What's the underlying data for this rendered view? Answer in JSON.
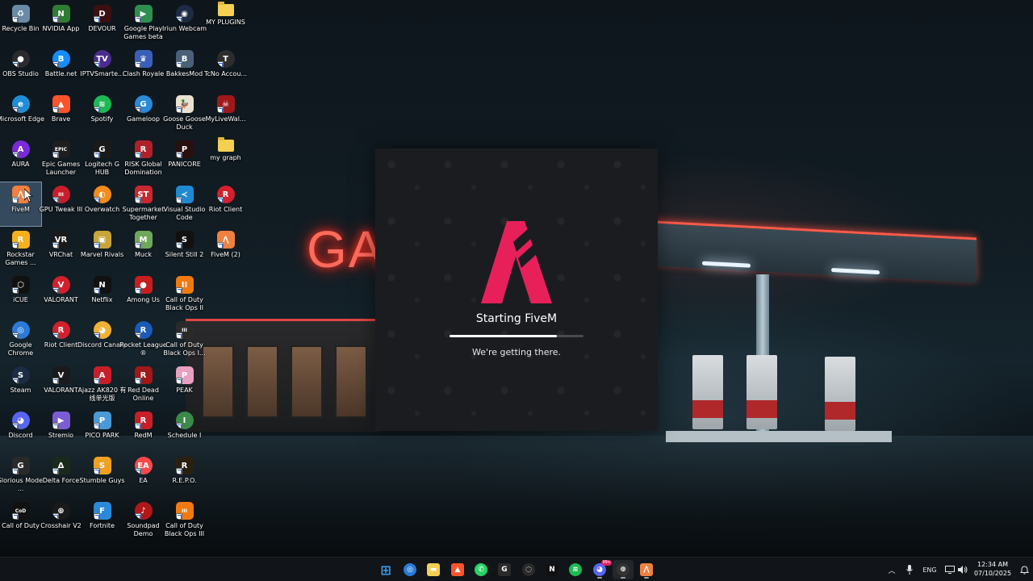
{
  "desktop": {
    "icons": [
      {
        "label": "Recycle Bin",
        "icon": "recycle-bin-icon",
        "color": "#6a8aa8",
        "glyph": "♻",
        "round": false
      },
      {
        "label": "NVIDIA App",
        "icon": "nvidia-icon",
        "color": "#2e7d32",
        "glyph": "N",
        "round": false
      },
      {
        "label": "DEVOUR",
        "icon": "devour-icon",
        "color": "#3a1010",
        "glyph": "D",
        "round": false
      },
      {
        "label": "Google Play Games beta",
        "icon": "google-play-games-icon",
        "color": "#2f8f4e",
        "glyph": "▶",
        "round": false
      },
      {
        "label": "Iriun Webcam",
        "icon": "iriun-webcam-icon",
        "color": "#1f2a44",
        "glyph": "◉",
        "round": true
      },
      {
        "label": "MY PLUGINS",
        "icon": "folder-icon",
        "color": "#f5cf52",
        "glyph": "",
        "round": false
      },
      {
        "label": "OBS Studio",
        "icon": "obs-studio-icon",
        "color": "#2b2b2f",
        "glyph": "●",
        "round": true
      },
      {
        "label": "Battle.net",
        "icon": "battlenet-icon",
        "color": "#148eff",
        "glyph": "B",
        "round": true
      },
      {
        "label": "IPTVSmarte...",
        "icon": "iptv-smarters-icon",
        "color": "#4b2c8c",
        "glyph": "TV",
        "round": true
      },
      {
        "label": "Clash Royale",
        "icon": "clash-royale-icon",
        "color": "#3a5fb8",
        "glyph": "♛",
        "round": false
      },
      {
        "label": "BakkesMod",
        "icon": "bakkesmod-icon",
        "color": "#4a6078",
        "glyph": "B",
        "round": false
      },
      {
        "label": "TcNo Accou...",
        "icon": "tcno-account-switcher-icon",
        "color": "#2d2d2d",
        "glyph": "T",
        "round": true
      },
      {
        "label": "Microsoft Edge",
        "icon": "edge-icon",
        "color": "#1f8ed6",
        "glyph": "e",
        "round": true
      },
      {
        "label": "Brave",
        "icon": "brave-icon",
        "color": "#fb542b",
        "glyph": "▲",
        "round": false
      },
      {
        "label": "Spotify",
        "icon": "spotify-icon",
        "color": "#1db954",
        "glyph": "≋",
        "round": true
      },
      {
        "label": "Gameloop",
        "icon": "gameloop-icon",
        "color": "#2a8ad8",
        "glyph": "G",
        "round": true
      },
      {
        "label": "Goose Goose Duck",
        "icon": "goose-goose-duck-icon",
        "color": "#e9e2d2",
        "glyph": "🦆",
        "round": false
      },
      {
        "label": "MyLiveWal...",
        "icon": "mylivewallpaper-icon",
        "color": "#a01818",
        "glyph": "☠",
        "round": false
      },
      {
        "label": "AURA",
        "icon": "aura-icon",
        "color": "#7a2ad8",
        "glyph": "A",
        "round": true
      },
      {
        "label": "Epic Games Launcher",
        "icon": "epic-games-icon",
        "color": "#1e1e1e",
        "glyph": "EPIC",
        "round": false
      },
      {
        "label": "Logitech G HUB",
        "icon": "logitech-g-hub-icon",
        "color": "#1a1a1a",
        "glyph": "G",
        "round": false
      },
      {
        "label": "RISK Global Domination",
        "icon": "risk-icon",
        "color": "#b0202a",
        "glyph": "R",
        "round": false
      },
      {
        "label": "PANICORE",
        "icon": "panicore-icon",
        "color": "#2a0f0f",
        "glyph": "P",
        "round": false
      },
      {
        "label": "my graph",
        "icon": "folder-icon",
        "color": "#f5cf52",
        "glyph": "",
        "round": false
      },
      {
        "label": "FiveM",
        "icon": "fivem-icon",
        "color": "#f08040",
        "glyph": "⋀",
        "round": false
      },
      {
        "label": "GPU Tweak III",
        "icon": "gpu-tweak-icon",
        "color": "#c81e2a",
        "glyph": "III",
        "round": true
      },
      {
        "label": "Overwatch",
        "icon": "overwatch-icon",
        "color": "#f28c1b",
        "glyph": "◐",
        "round": true
      },
      {
        "label": "Supermarket Together",
        "icon": "supermarket-together-icon",
        "color": "#c8282e",
        "glyph": "ST",
        "round": false
      },
      {
        "label": "Visual Studio Code",
        "icon": "vscode-icon",
        "color": "#1f8ad2",
        "glyph": "≺",
        "round": false
      },
      {
        "label": "Riot Client",
        "icon": "riot-client-icon",
        "color": "#d4202c",
        "glyph": "R",
        "round": true
      },
      {
        "label": "Rockstar Games ...",
        "icon": "rockstar-games-icon",
        "color": "#f6b01a",
        "glyph": "R",
        "round": false
      },
      {
        "label": "VRChat",
        "icon": "vrchat-icon",
        "color": "#1a1a1a",
        "glyph": "VR",
        "round": false
      },
      {
        "label": "Marvel Rivals",
        "icon": "marvel-rivals-icon",
        "color": "#c8a53a",
        "glyph": "▣",
        "round": false
      },
      {
        "label": "Muck",
        "icon": "muck-icon",
        "color": "#6fa85a",
        "glyph": "M",
        "round": false
      },
      {
        "label": "Silent Still 2",
        "icon": "silent-still-icon",
        "color": "#111111",
        "glyph": "S",
        "round": false
      },
      {
        "label": "FiveM (2)",
        "icon": "fivem-icon",
        "color": "#f08040",
        "glyph": "⋀",
        "round": false
      },
      {
        "label": "iCUE",
        "icon": "icue-icon",
        "color": "#111111",
        "glyph": "⬡",
        "round": false
      },
      {
        "label": "VALORANT",
        "icon": "valorant-icon",
        "color": "#d4202c",
        "glyph": "V",
        "round": true
      },
      {
        "label": "Netflix",
        "icon": "netflix-icon",
        "color": "#111111",
        "glyph": "N",
        "round": false
      },
      {
        "label": "Among Us",
        "icon": "among-us-icon",
        "color": "#c81e1e",
        "glyph": "●",
        "round": false
      },
      {
        "label": "Call of Duty Black Ops II",
        "icon": "black-ops-icon",
        "color": "#f07a12",
        "glyph": "II",
        "round": false
      },
      {
        "label": "Google Chrome",
        "icon": "chrome-icon",
        "color": "#2a7ad8",
        "glyph": "◎",
        "round": true
      },
      {
        "label": "Riot Client",
        "icon": "riot-client-icon",
        "color": "#d4202c",
        "glyph": "R",
        "round": true
      },
      {
        "label": "Discord Canary",
        "icon": "discord-canary-icon",
        "color": "#f0b232",
        "glyph": "◕",
        "round": true
      },
      {
        "label": "Rocket League ®",
        "icon": "rocket-league-icon",
        "color": "#1a5ab8",
        "glyph": "R",
        "round": true
      },
      {
        "label": "Call of Duty Black Ops I...",
        "icon": "black-ops-icon",
        "color": "#2a2a2a",
        "glyph": "III",
        "round": false
      },
      {
        "label": "Steam",
        "icon": "steam-icon",
        "color": "#1b2c44",
        "glyph": "S",
        "round": true
      },
      {
        "label": "VALORANT",
        "icon": "valorant-icon",
        "color": "#1a1a1e",
        "glyph": "V",
        "round": false
      },
      {
        "label": "Ajazz AK820 有线单光版",
        "icon": "ajazz-keyboard-icon",
        "color": "#c81e2a",
        "glyph": "A",
        "round": false
      },
      {
        "label": "Red Dead Online",
        "icon": "red-dead-online-icon",
        "color": "#a01818",
        "glyph": "R",
        "round": false
      },
      {
        "label": "PEAK",
        "icon": "peak-icon",
        "color": "#e8a0c0",
        "glyph": "P",
        "round": false
      },
      {
        "label": "Discord",
        "icon": "discord-icon",
        "color": "#5865f2",
        "glyph": "◕",
        "round": true
      },
      {
        "label": "Stremio",
        "icon": "stremio-icon",
        "color": "#7b5bd6",
        "glyph": "▶",
        "round": false
      },
      {
        "label": "PICO PARK",
        "icon": "pico-park-icon",
        "color": "#4a9ad8",
        "glyph": "P",
        "round": false
      },
      {
        "label": "RedM",
        "icon": "redm-icon",
        "color": "#c81e2a",
        "glyph": "R",
        "round": false
      },
      {
        "label": "Schedule I",
        "icon": "schedule-one-icon",
        "color": "#3a8a4a",
        "glyph": "I",
        "round": true
      },
      {
        "label": "Glorious Model ...",
        "icon": "glorious-model-icon",
        "color": "#2a2a2a",
        "glyph": "G",
        "round": false
      },
      {
        "label": "Delta Force",
        "icon": "delta-force-icon",
        "color": "#1a2a1a",
        "glyph": "Δ",
        "round": false
      },
      {
        "label": "Stumble Guys",
        "icon": "stumble-guys-icon",
        "color": "#f0a020",
        "glyph": "S",
        "round": false
      },
      {
        "label": "EA",
        "icon": "ea-icon",
        "color": "#ff4747",
        "glyph": "EA",
        "round": true
      },
      {
        "label": "R.E.P.O.",
        "icon": "repo-icon",
        "color": "#2a2010",
        "glyph": "R",
        "round": false
      },
      {
        "label": "Call of Duty",
        "icon": "call-of-duty-icon",
        "color": "#111111",
        "glyph": "CoD",
        "round": false
      },
      {
        "label": "Crosshair V2",
        "icon": "crosshair-icon",
        "color": "#1a1a1a",
        "glyph": "⊕",
        "round": true
      },
      {
        "label": "Fortnite",
        "icon": "fortnite-icon",
        "color": "#2a8ad8",
        "glyph": "F",
        "round": false
      },
      {
        "label": "Soundpad Demo",
        "icon": "soundpad-icon",
        "color": "#b01818",
        "glyph": "♪",
        "round": true
      },
      {
        "label": "Call of Duty Black Ops III",
        "icon": "black-ops-icon",
        "color": "#f07a12",
        "glyph": "III",
        "round": false
      }
    ]
  },
  "splash": {
    "title": "Starting FiveM",
    "subtitle": "We're getting there.",
    "progress": 0.8,
    "accent": "#e8205a",
    "background": "#1b1c20"
  },
  "taskbar": {
    "apps": [
      {
        "name": "start-button",
        "icon": "windows-icon",
        "color": "#3aa0f0",
        "glyph": "⊞",
        "running": false,
        "active": false
      },
      {
        "name": "chrome-taskbar-button",
        "icon": "chrome-icon",
        "color": "#2a7ad8",
        "glyph": "◎",
        "running": false,
        "active": false
      },
      {
        "name": "file-explorer-taskbar-button",
        "icon": "folder-icon",
        "color": "#f5cf52",
        "glyph": "▬",
        "running": false,
        "active": false
      },
      {
        "name": "brave-taskbar-button",
        "icon": "brave-icon",
        "color": "#fb542b",
        "glyph": "▲",
        "running": false,
        "active": false
      },
      {
        "name": "whatsapp-taskbar-button",
        "icon": "whatsapp-icon",
        "color": "#25d366",
        "glyph": "✆",
        "running": false,
        "active": false
      },
      {
        "name": "logitech-g-hub-taskbar-button",
        "icon": "logitech-g-hub-icon",
        "color": "#2a2a2a",
        "glyph": "G",
        "running": false,
        "active": false
      },
      {
        "name": "crosshair-taskbar-button",
        "icon": "crosshair-icon",
        "color": "#2a2a2a",
        "glyph": "◌",
        "running": false,
        "active": false
      },
      {
        "name": "netflix-taskbar-button",
        "icon": "netflix-icon",
        "color": "#111111",
        "glyph": "N",
        "running": false,
        "active": false
      },
      {
        "name": "spotify-taskbar-button",
        "icon": "spotify-icon",
        "color": "#1db954",
        "glyph": "≋",
        "running": false,
        "active": false
      },
      {
        "name": "discord-taskbar-button",
        "icon": "discord-icon",
        "color": "#5865f2",
        "glyph": "◕",
        "running": true,
        "active": false
      },
      {
        "name": "crosshair-v2-taskbar-button",
        "icon": "crosshair-v2-icon",
        "color": "#333333",
        "glyph": "⊕",
        "running": true,
        "active": true
      },
      {
        "name": "fivem-taskbar-button",
        "icon": "fivem-icon",
        "color": "#f08040",
        "glyph": "⋀",
        "running": true,
        "active": false
      }
    ],
    "discord_badge": "99+",
    "language": "ENG",
    "time": "12:34 AM",
    "date": "07/10/2025"
  }
}
